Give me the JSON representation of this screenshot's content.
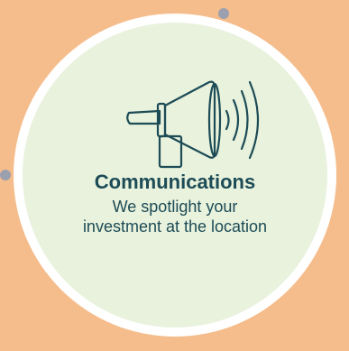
{
  "card": {
    "title": "Communications",
    "description": "We spotlight your investment at the location",
    "icon": "megaphone-icon"
  },
  "colors": {
    "background": "#f6bd8c",
    "circle_fill": "#e8f2dd",
    "circle_ring": "#ffffff",
    "text": "#1d4b56",
    "accent_dot": "#9aa0ae"
  }
}
